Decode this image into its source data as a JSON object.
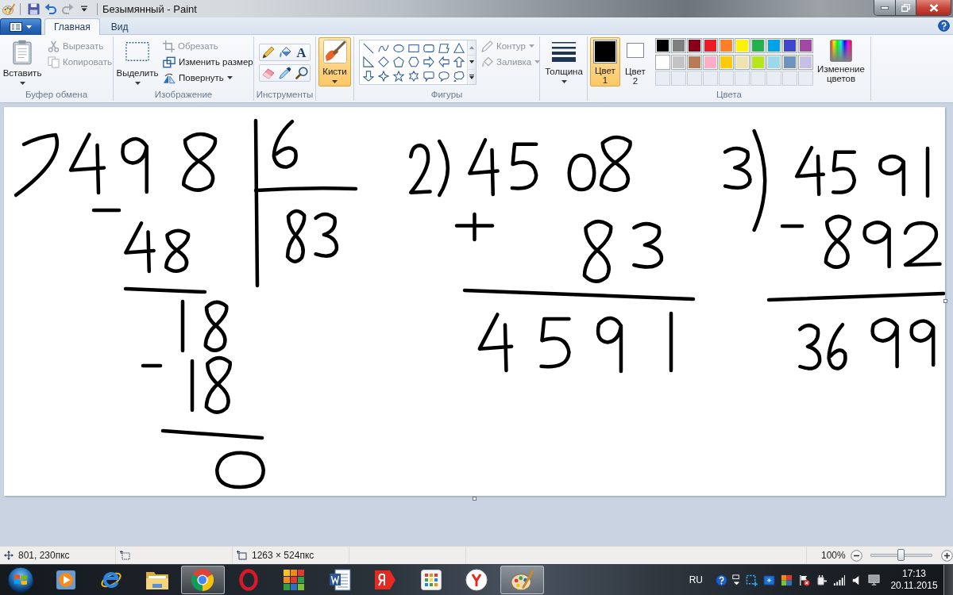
{
  "window": {
    "title": "Безымянный - Paint"
  },
  "quick_access": [
    {
      "kind": "save",
      "disabled": false
    },
    {
      "kind": "undo",
      "disabled": false
    },
    {
      "kind": "redo",
      "disabled": true
    }
  ],
  "ribbon": {
    "tabs": [
      {
        "label": "Главная",
        "selected": true
      },
      {
        "label": "Вид",
        "selected": false
      }
    ],
    "clipboard": {
      "label": "Буфер обмена",
      "paste": "Вставить",
      "cut": {
        "label": "Вырезать",
        "disabled": true
      },
      "copy": {
        "label": "Копировать",
        "disabled": true
      }
    },
    "image": {
      "label": "Изображение",
      "select": "Выделить",
      "crop": {
        "label": "Обрезать",
        "disabled": true
      },
      "resize": {
        "label": "Изменить размер",
        "disabled": false
      },
      "rotate": {
        "label": "Повернуть",
        "disabled": false
      }
    },
    "tools": {
      "label": "Инструменты",
      "items": [
        {
          "kind": "pencil"
        },
        {
          "kind": "fill"
        },
        {
          "kind": "text",
          "glyph": "A"
        },
        {
          "kind": "eraser"
        },
        {
          "kind": "picker"
        },
        {
          "kind": "magnifier"
        }
      ]
    },
    "brushes": {
      "label": "Кисти",
      "selected": true
    },
    "shapes": {
      "label": "Фигуры",
      "outline": {
        "label": "Контур",
        "disabled": true
      },
      "fill": {
        "label": "Заливка",
        "disabled": true
      }
    },
    "size": {
      "label": "Толщина"
    },
    "colors": {
      "label": "Цвета",
      "color1": {
        "label": "Цвет 1",
        "color": "#000000",
        "selected": true
      },
      "color2": {
        "label": "Цвет 2",
        "color": "#ffffff",
        "selected": false
      },
      "palette": [
        {
          "kind": "swatch",
          "color": "#000000"
        },
        {
          "kind": "swatch",
          "color": "#7f7f7f"
        },
        {
          "kind": "swatch",
          "color": "#880015"
        },
        {
          "kind": "swatch",
          "color": "#ed1c24"
        },
        {
          "kind": "swatch",
          "color": "#ff7f27"
        },
        {
          "kind": "swatch",
          "color": "#fff200"
        },
        {
          "kind": "swatch",
          "color": "#22b14c"
        },
        {
          "kind": "swatch",
          "color": "#00a2e8"
        },
        {
          "kind": "swatch",
          "color": "#3f48cc"
        },
        {
          "kind": "swatch",
          "color": "#a349a4"
        },
        {
          "kind": "swatch",
          "color": "#ffffff"
        },
        {
          "kind": "swatch",
          "color": "#c3c3c3"
        },
        {
          "kind": "swatch",
          "color": "#b97a57"
        },
        {
          "kind": "swatch",
          "color": "#ffaec9"
        },
        {
          "kind": "swatch",
          "color": "#ffc90e"
        },
        {
          "kind": "swatch",
          "color": "#efe4b0"
        },
        {
          "kind": "swatch",
          "color": "#b5e61d"
        },
        {
          "kind": "swatch",
          "color": "#99d9ea"
        },
        {
          "kind": "swatch",
          "color": "#7092be"
        },
        {
          "kind": "swatch",
          "color": "#c8bfe7"
        },
        {
          "kind": "empty"
        },
        {
          "kind": "empty"
        },
        {
          "kind": "empty"
        },
        {
          "kind": "empty"
        },
        {
          "kind": "empty"
        },
        {
          "kind": "empty"
        },
        {
          "kind": "empty"
        },
        {
          "kind": "empty"
        },
        {
          "kind": "empty"
        },
        {
          "kind": "empty"
        }
      ],
      "edit": "Изменение цветов"
    }
  },
  "status_bar": {
    "cursor": "801, 230пкс",
    "canvas_size": "1263 × 524пкс",
    "zoom": "100%",
    "zoom_slider": {
      "level": 0.5
    }
  },
  "taskbar": {
    "apps": [
      {
        "kind": "media",
        "selected": false
      },
      {
        "kind": "ie",
        "selected": false
      },
      {
        "kind": "folder",
        "selected": false
      },
      {
        "kind": "chrome",
        "selected": true
      },
      {
        "kind": "opera",
        "selected": false
      },
      {
        "kind": "avg",
        "selected": false
      },
      {
        "kind": "word",
        "selected": false
      },
      {
        "kind": "yandex",
        "selected": false
      },
      {
        "kind": "grid",
        "selected": false
      },
      {
        "kind": "ybrowser",
        "selected": false
      },
      {
        "kind": "paint",
        "selected": true
      }
    ],
    "tray": {
      "language": "RU",
      "time": "17:13",
      "date": "20.11.2015"
    }
  }
}
